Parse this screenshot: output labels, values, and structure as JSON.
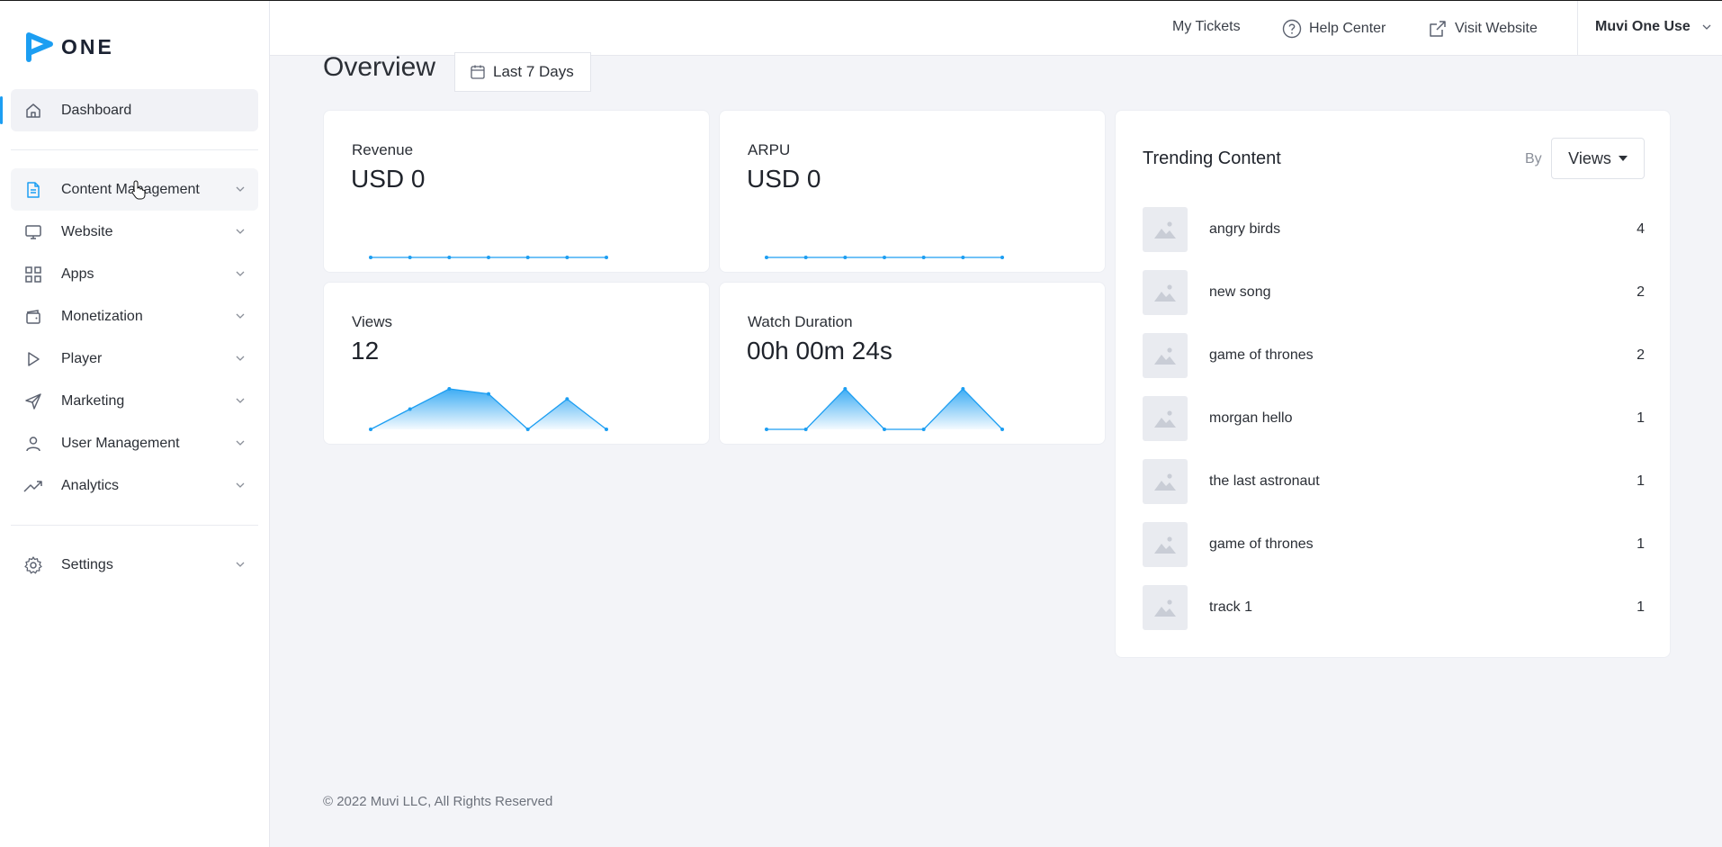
{
  "brand": {
    "logo_text": "ONE",
    "accent": "#1c9ef2"
  },
  "header": {
    "my_tickets": "My Tickets",
    "help_center": "Help Center",
    "visit_website": "Visit Website",
    "user_menu": "Muvi One Use"
  },
  "sidebar": {
    "items": [
      {
        "label": "Dashboard",
        "icon": "home-icon",
        "active": true
      },
      {
        "label": "Content Management",
        "icon": "document-icon"
      },
      {
        "label": "Website",
        "icon": "monitor-icon"
      },
      {
        "label": "Apps",
        "icon": "grid-icon"
      },
      {
        "label": "Monetization",
        "icon": "wallet-icon"
      },
      {
        "label": "Player",
        "icon": "play-icon"
      },
      {
        "label": "Marketing",
        "icon": "send-icon"
      },
      {
        "label": "User Management",
        "icon": "user-icon"
      },
      {
        "label": "Analytics",
        "icon": "trend-icon"
      },
      {
        "label": "Settings",
        "icon": "gear-icon"
      }
    ]
  },
  "main": {
    "title": "Overview",
    "date_range": "Last 7 Days",
    "cards": [
      {
        "label": "Revenue",
        "value": "USD 0"
      },
      {
        "label": "ARPU",
        "value": "USD 0"
      },
      {
        "label": "Views",
        "value": "12"
      },
      {
        "label": "Watch Duration",
        "value": "00h 00m 24s"
      }
    ]
  },
  "trending": {
    "title": "Trending Content",
    "by_label": "By",
    "sort_value": "Views",
    "items": [
      {
        "name": "angry birds",
        "count": "4"
      },
      {
        "name": "new song",
        "count": "2"
      },
      {
        "name": "game of thrones",
        "count": "2"
      },
      {
        "name": "morgan hello",
        "count": "1"
      },
      {
        "name": "the last astronaut",
        "count": "1"
      },
      {
        "name": "game of thrones",
        "count": "1"
      },
      {
        "name": "track 1",
        "count": "1"
      }
    ]
  },
  "footer": {
    "copyright": "© 2022 Muvi LLC, All Rights Reserved"
  },
  "chart_data": [
    {
      "type": "line",
      "values": [
        0,
        0,
        0,
        0,
        0,
        0,
        0
      ]
    },
    {
      "type": "line",
      "values": [
        0,
        0,
        0,
        0,
        0,
        0,
        0
      ]
    },
    {
      "type": "area",
      "values": [
        0,
        2,
        4,
        3.5,
        0,
        3,
        0
      ]
    },
    {
      "type": "area",
      "values": [
        0,
        0,
        4,
        0,
        0,
        4,
        0
      ]
    }
  ]
}
